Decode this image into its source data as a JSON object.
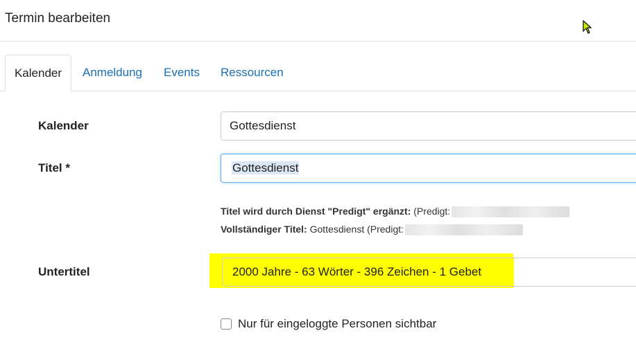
{
  "modal": {
    "title": "Termin bearbeiten"
  },
  "tabs": [
    {
      "label": "Kalender",
      "active": true
    },
    {
      "label": "Anmeldung",
      "active": false
    },
    {
      "label": "Events",
      "active": false
    },
    {
      "label": "Ressourcen",
      "active": false
    }
  ],
  "form": {
    "calendar": {
      "label": "Kalender",
      "value": "Gottesdienst"
    },
    "title": {
      "label": "Titel *",
      "value": "Gottesdienst",
      "help1_bold": "Titel wird durch Dienst \"Predigt\" ergänzt:",
      "help1_text": " (Predigt:",
      "help2_bold": "Vollständiger Titel:",
      "help2_text": " Gottesdienst (Predigt:"
    },
    "subtitle": {
      "label": "Untertitel",
      "value": "2000 Jahre - 63 Wörter - 396 Zeichen - 1 Gebet"
    },
    "visibility": {
      "label": "Nur für eingeloggte Personen sichtbar",
      "checked": false
    }
  },
  "colors": {
    "link": "#1a6fb5",
    "highlight": "#ffff00",
    "focus_border": "#66afe9"
  }
}
